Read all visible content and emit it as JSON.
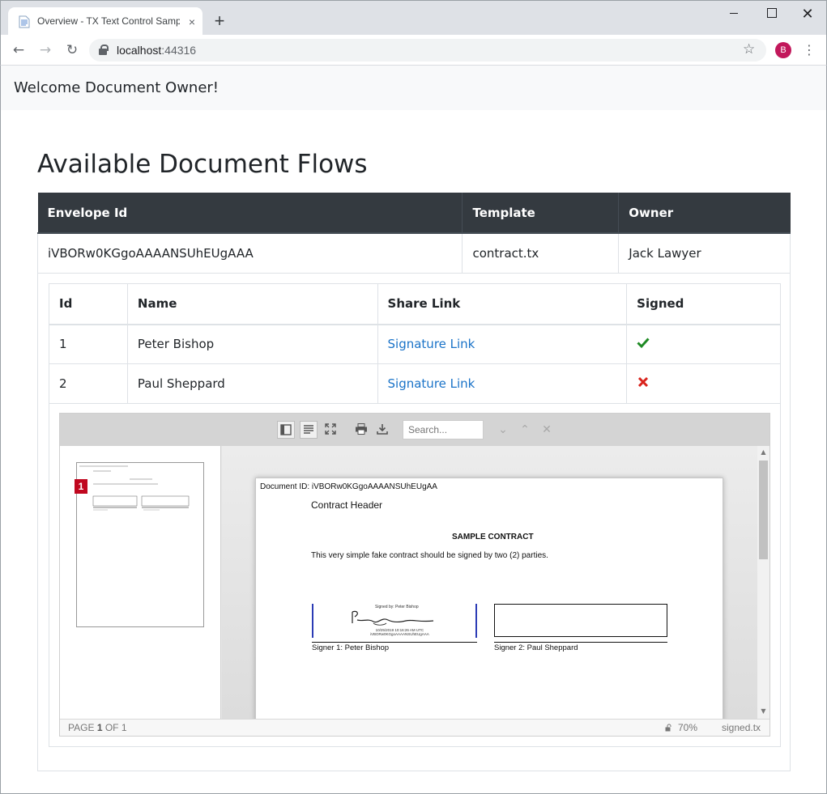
{
  "browser": {
    "tab_title": "Overview - TX Text Control Samp",
    "tab_close": "×",
    "new_tab": "+",
    "url_host": "localhost",
    "url_port": ":44316",
    "profile_initial": "B"
  },
  "navbar": {
    "brand": "Welcome Document Owner!"
  },
  "page": {
    "title": "Available Document Flows"
  },
  "envelopes": {
    "headers": [
      "Envelope Id",
      "Template",
      "Owner"
    ],
    "rows": [
      {
        "envelope_id": "iVBORw0KGgoAAAANSUhEUgAAA",
        "template": "contract.tx",
        "owner": "Jack Lawyer"
      }
    ]
  },
  "signers": {
    "headers": [
      "Id",
      "Name",
      "Share Link",
      "Signed"
    ],
    "rows": [
      {
        "id": "1",
        "name": "Peter Bishop",
        "link": "Signature Link",
        "signed": true
      },
      {
        "id": "2",
        "name": "Paul Sheppard",
        "link": "Signature Link",
        "signed": false
      }
    ]
  },
  "colors": {
    "signed_true": "#1e8a24",
    "signed_false": "#d9231c",
    "link": "#1a73c8"
  },
  "viewer": {
    "search_placeholder": "Search...",
    "thumbnail_badge": "1",
    "document": {
      "doc_id": "Document ID: iVBORw0KGgoAAAANSUhEUgAA",
      "header": "Contract Header",
      "title": "SAMPLE CONTRACT",
      "body": "This very simple fake contract should be signed by two (2) parties.",
      "signed_by": "Signed by: Peter Bishop",
      "stamp_line1": "10/25/2019 10:16:26 AM UTC",
      "stamp_line2": "iVBORw0KGgoAAAANSUhEUgAAA",
      "signer1_label": "Signer 1: Peter Bishop",
      "signer2_label": "Signer 2: Paul Sheppard"
    },
    "status": {
      "page_prefix": "PAGE",
      "page_current": "1",
      "page_of": "OF 1",
      "zoom": "70%",
      "filename": "signed.tx"
    }
  }
}
